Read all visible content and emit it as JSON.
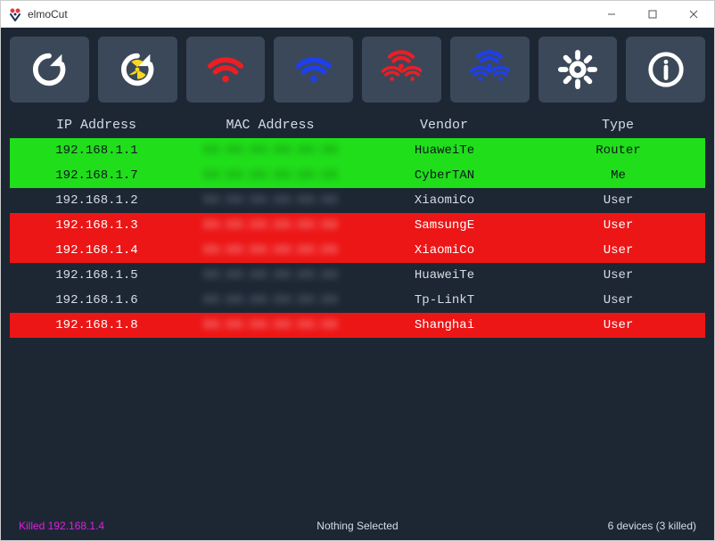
{
  "window": {
    "title": "elmoCut"
  },
  "toolbar": {
    "icons": [
      {
        "name": "refresh",
        "role": "reload"
      },
      {
        "name": "scan-radiate",
        "role": "scan"
      },
      {
        "name": "wifi-red",
        "role": "cut-one"
      },
      {
        "name": "wifi-blue",
        "role": "uncut-one"
      },
      {
        "name": "wifi-red-all",
        "role": "cut-all"
      },
      {
        "name": "wifi-blue-all",
        "role": "uncut-all"
      },
      {
        "name": "gear",
        "role": "settings"
      },
      {
        "name": "info",
        "role": "about"
      }
    ]
  },
  "table": {
    "columns": [
      "IP Address",
      "MAC Address",
      "Vendor",
      "Type"
    ],
    "rows": [
      {
        "ip": "192.168.1.1",
        "mac": "XX:XX:XX:XX:XX:XX",
        "vendor": "HuaweiTe",
        "type": "Router",
        "state": "green"
      },
      {
        "ip": "192.168.1.7",
        "mac": "XX:XX:XX:XX:XX:XX",
        "vendor": "CyberTAN",
        "type": "Me",
        "state": "green"
      },
      {
        "ip": "192.168.1.2",
        "mac": "XX:XX:XX:XX:XX:XX",
        "vendor": "XiaomiCo",
        "type": "User",
        "state": "dark"
      },
      {
        "ip": "192.168.1.3",
        "mac": "XX:XX:XX:XX:XX:XX",
        "vendor": "SamsungE",
        "type": "User",
        "state": "red"
      },
      {
        "ip": "192.168.1.4",
        "mac": "XX:XX:XX:XX:XX:XX",
        "vendor": "XiaomiCo",
        "type": "User",
        "state": "red"
      },
      {
        "ip": "192.168.1.5",
        "mac": "XX:XX:XX:XX:XX:XX",
        "vendor": "HuaweiTe",
        "type": "User",
        "state": "dark"
      },
      {
        "ip": "192.168.1.6",
        "mac": "XX:XX:XX:XX:XX:XX",
        "vendor": "Tp-LinkT",
        "type": "User",
        "state": "dark"
      },
      {
        "ip": "192.168.1.8",
        "mac": "XX:XX:XX:XX:XX:XX",
        "vendor": "Shanghai",
        "type": "User",
        "state": "red"
      }
    ]
  },
  "status": {
    "left": "Killed 192.168.1.4",
    "center": "Nothing Selected",
    "right": "6 devices (3 killed)"
  },
  "colors": {
    "bg": "#1d2734",
    "btn": "#3b4859",
    "green": "#20de1a",
    "red": "#ec1616",
    "iconRed": "#ec1e24",
    "iconBlue": "#1e3fec",
    "iconWhite": "#ffffff",
    "statusPink": "#e01ee0"
  }
}
